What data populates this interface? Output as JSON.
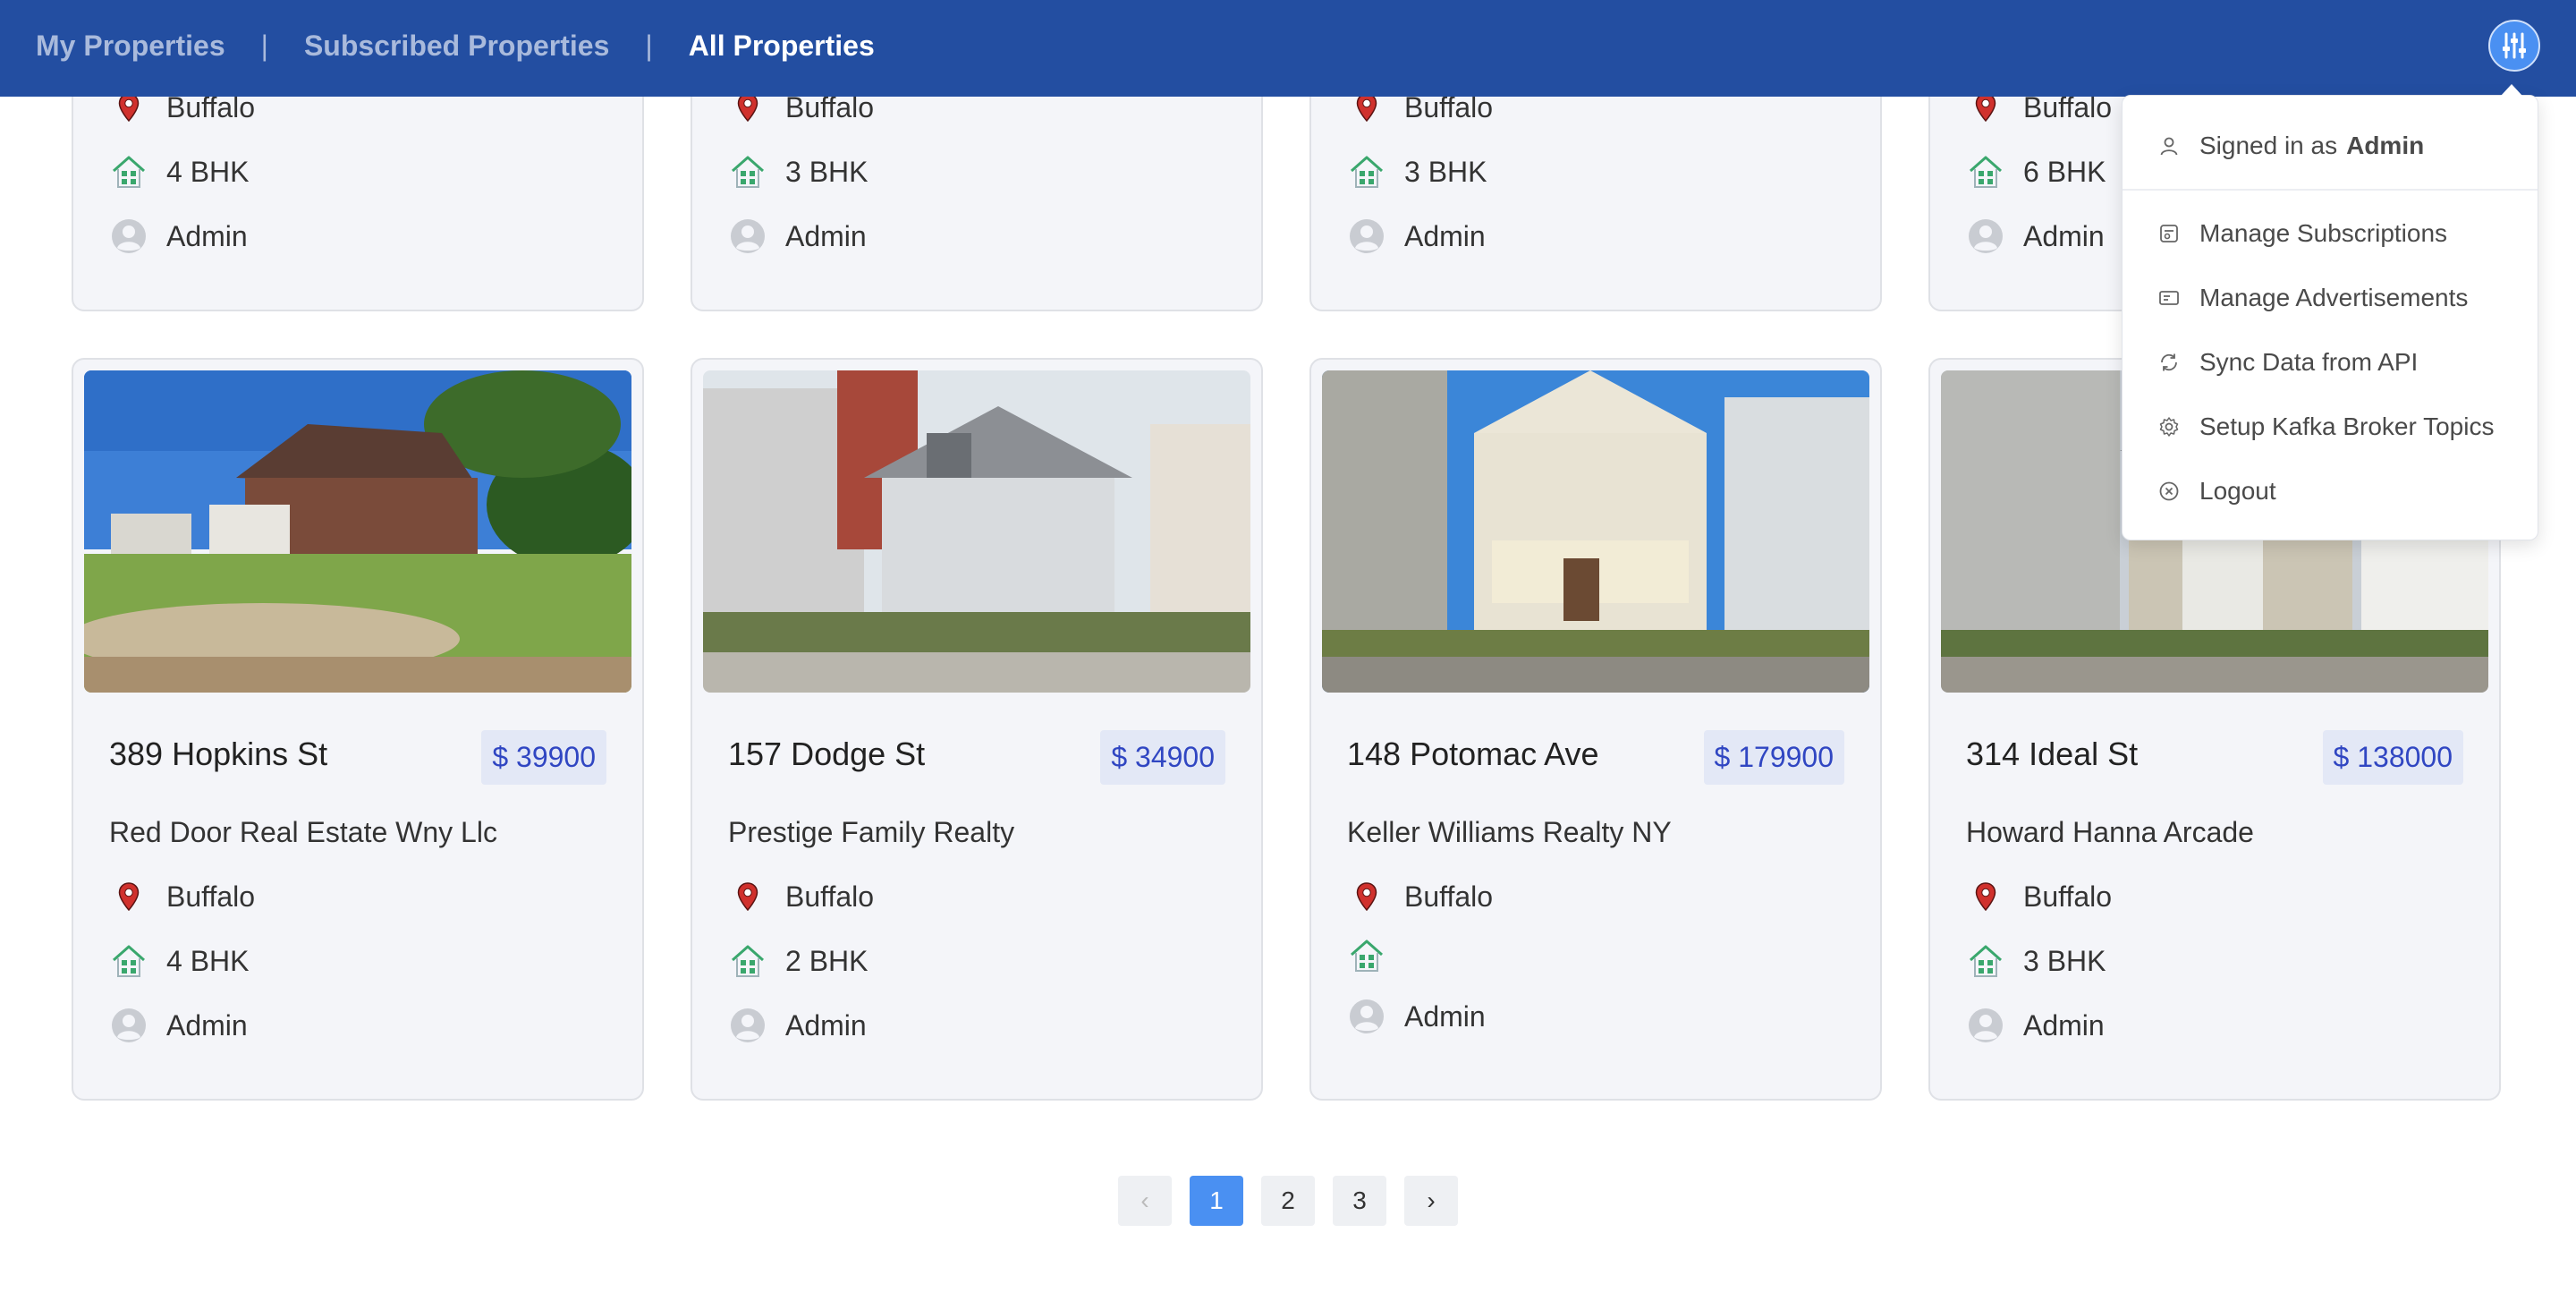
{
  "nav": {
    "links": [
      "My Properties",
      "Subscribed Properties",
      "All Properties"
    ],
    "separator": "|",
    "active_link": "All Properties"
  },
  "colors": {
    "navbar": "#234ea1",
    "accent": "#4a90f2",
    "price_text": "#3046c2",
    "location_pin": "#d0312d",
    "house_icon": "#3aa76d"
  },
  "top_row": [
    {
      "location": "Buffalo",
      "bhk": "4 BHK",
      "owner": "Admin"
    },
    {
      "location": "Buffalo",
      "bhk": "3 BHK",
      "owner": "Admin"
    },
    {
      "location": "Buffalo",
      "bhk": "3 BHK",
      "owner": "Admin"
    },
    {
      "location": "Buffalo",
      "bhk": "6 BHK",
      "owner": "Admin"
    }
  ],
  "properties": [
    {
      "title": "389 Hopkins St",
      "price": "$ 39900",
      "agency": "Red Door Real Estate Wny Llc",
      "location": "Buffalo",
      "bhk": "4 BHK",
      "owner": "Admin"
    },
    {
      "title": "157 Dodge St",
      "price": "$ 34900",
      "agency": "Prestige Family Realty",
      "location": "Buffalo",
      "bhk": "2 BHK",
      "owner": "Admin"
    },
    {
      "title": "148 Potomac Ave",
      "price": "$ 179900",
      "agency": "Keller Williams Realty NY",
      "location": "Buffalo",
      "bhk": "",
      "owner": "Admin"
    },
    {
      "title": "314 Ideal St",
      "price": "$ 138000",
      "agency": "Howard Hanna Arcade",
      "location": "Buffalo",
      "bhk": "3 BHK",
      "owner": "Admin"
    }
  ],
  "user_menu": {
    "signed_in_prefix": "Signed in as",
    "username": "Admin",
    "items": [
      {
        "label": "Manage Subscriptions",
        "icon": "subscriptions-icon"
      },
      {
        "label": "Manage Advertisements",
        "icon": "advertisement-icon"
      },
      {
        "label": "Sync Data from API",
        "icon": "sync-icon"
      },
      {
        "label": "Setup Kafka Broker Topics",
        "icon": "gear-icon"
      },
      {
        "label": "Logout",
        "icon": "close-circle-icon"
      }
    ]
  },
  "pagination": {
    "prev": "‹",
    "pages": [
      "1",
      "2",
      "3"
    ],
    "current": "1",
    "next": "›"
  }
}
